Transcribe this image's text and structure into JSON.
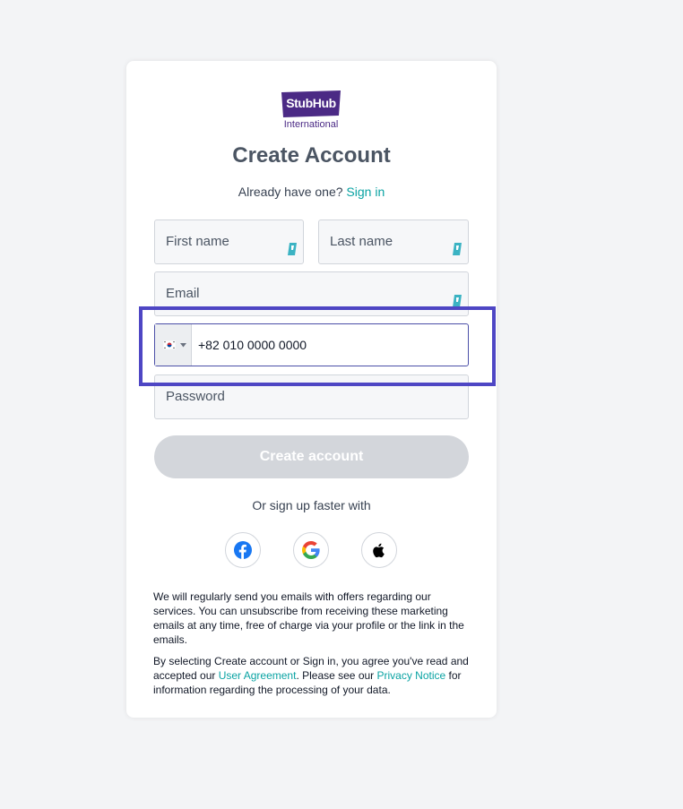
{
  "logo": {
    "brand": "StubHub",
    "subtitle": "International",
    "color": "#4b2a85"
  },
  "title": "Create Account",
  "signin": {
    "prompt": "Already have one?",
    "link": "Sign in"
  },
  "fields": {
    "first_name": {
      "placeholder": "First name",
      "icon": "password-manager-icon"
    },
    "last_name": {
      "placeholder": "Last name",
      "icon": "password-manager-icon"
    },
    "email": {
      "placeholder": "Email",
      "icon": "password-manager-icon"
    },
    "phone": {
      "country": "South Korea",
      "flag_icon": "south-korea-flag-icon",
      "value": "+82 010 0000 0000"
    },
    "password": {
      "placeholder": "Password"
    }
  },
  "create_button": "Create account",
  "social": {
    "prompt": "Or sign up faster with",
    "buttons": [
      "facebook-icon",
      "google-icon",
      "apple-icon"
    ]
  },
  "notes": {
    "marketing": "We will regularly send you emails with offers regarding our services. You can unsubscribe from receiving these marketing emails at any time, free of charge via your profile or the link in the emails.",
    "terms_pre": "By selecting Create account or Sign in, you agree you've read and accepted our ",
    "terms_link1": "User Agreement",
    "terms_mid": ". Please see our ",
    "terms_link2": "Privacy Notice",
    "terms_post": " for information regarding the processing of your data."
  },
  "colors": {
    "accent_link": "#0aa3a3",
    "highlight_border": "#4e46c4",
    "button_disabled": "#d3d6db"
  }
}
